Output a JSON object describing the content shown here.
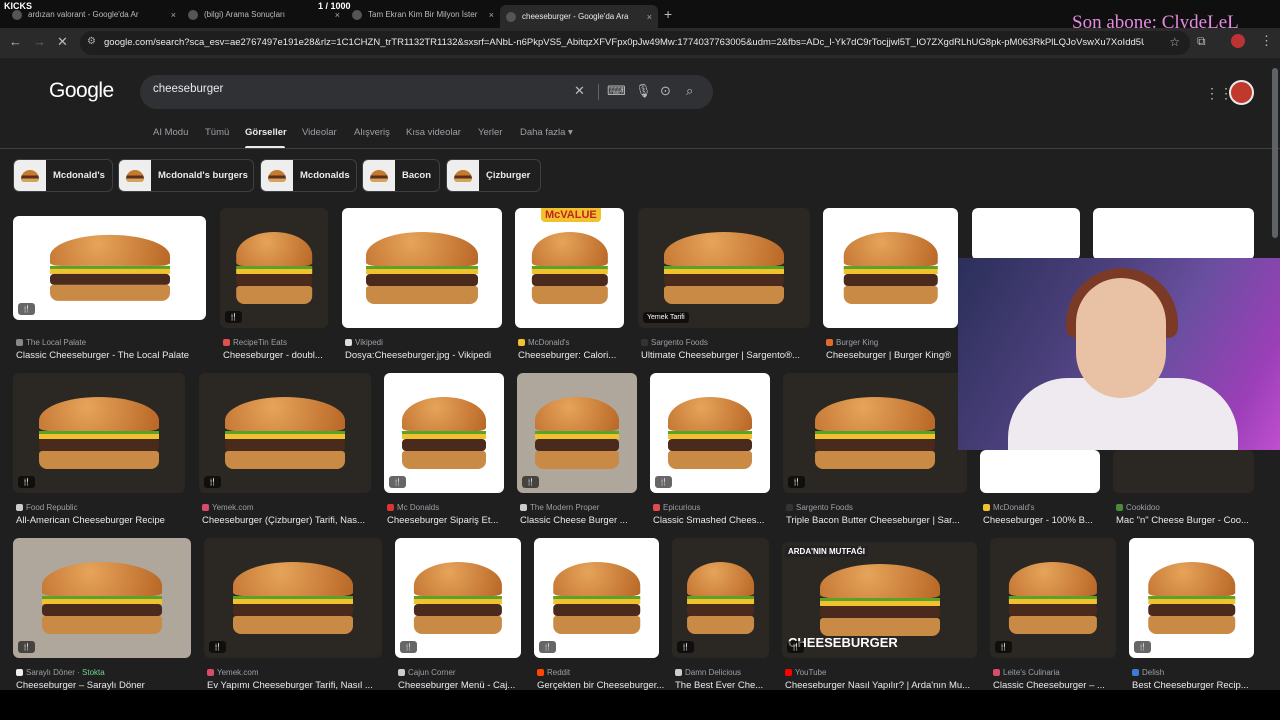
{
  "overlay": {
    "kicks": "KICKS",
    "counter": "1 / 1000",
    "subscriber": "Son abone: ClydeLeL"
  },
  "tabs": [
    {
      "title": "ardızan valorant - Google'da Ar",
      "close": "×"
    },
    {
      "title": "(bilgi) Arama Sonuçları",
      "close": "×"
    },
    {
      "title": "Tam Ekran Kim Bir Milyon İster",
      "close": "×"
    },
    {
      "title": "cheeseburger - Google'da Ara",
      "close": "×"
    }
  ],
  "new_tab": "+",
  "toolbar": {
    "url": "google.com/search?sca_esv=ae2767497e191e28&rlz=1C1CHZN_trTR1132TR1132&sxsrf=ANbL-n6PkpVS5_AbitqzXFVFpx0pJw49Mw:1774037763005&udm=2&fbs=ADc_l-Yk7dC9rTocjjwl5T_IO7ZXgdRLhUG8pk-pM063RkPlLQJoVswXu7XoIdd5UH6fMlpVmVqk..."
  },
  "google": {
    "logo": "Google",
    "query": "cheeseburger",
    "nav": [
      "AI Modu",
      "Tümü",
      "Görseller",
      "Videolar",
      "Alışveriş",
      "Kısa videolar",
      "Yerler",
      "Daha fazla ▾"
    ]
  },
  "chips": [
    "Mcdonald's",
    "Mcdonald's burgers",
    "Mcdonalds",
    "Bacon",
    "Çizburger"
  ],
  "results": [
    {
      "source": "The Local Palate",
      "title": "Classic Cheeseburger - The Local Palate",
      "fav": "#888888"
    },
    {
      "source": "RecipeTin Eats",
      "title": "Cheeseburger - doubl...",
      "fav": "#e05050"
    },
    {
      "source": "Vikipedi",
      "title": "Dosya:Cheeseburger.jpg - Vikipedi",
      "fav": "#dddddd"
    },
    {
      "source": "McDonald's",
      "title": "Cheeseburger: Calori...",
      "fav": "#f2c12e",
      "image_text": "McVALUE"
    },
    {
      "source": "Sargento Foods",
      "title": "Ultimate Cheeseburger | Sargento®...",
      "fav": "#333333",
      "badge": "Yemek Tarifi"
    },
    {
      "source": "Burger King",
      "title": "Cheeseburger | Burger King®",
      "fav": "#e36b2a"
    },
    {
      "source": "",
      "title": "",
      "fav": "#888888"
    },
    {
      "source": "",
      "title": "",
      "fav": "#888888"
    },
    {
      "source": "Food Republic",
      "title": "All-American Cheeseburger Recipe",
      "fav": "#cccccc"
    },
    {
      "source": "Yemek.com",
      "title": "Cheeseburger (Çizburger) Tarifi, Nas...",
      "fav": "#d94b6a"
    },
    {
      "source": "Mc Donalds",
      "title": "Cheeseburger Sipariş Et...",
      "fav": "#d33"
    },
    {
      "source": "The Modern Proper",
      "title": "Classic Cheese Burger ...",
      "fav": "#cccccc"
    },
    {
      "source": "Epicurious",
      "title": "Classic Smashed Chees...",
      "fav": "#e34b4b"
    },
    {
      "source": "Sargento Foods",
      "title": "Triple Bacon Butter Cheeseburger | Sar...",
      "fav": "#333333"
    },
    {
      "source": "McDonald's",
      "title": "Cheeseburger - 100% B...",
      "fav": "#f2c12e"
    },
    {
      "source": "Cookidoo",
      "title": "Mac \"n\" Cheese Burger - Coo...",
      "fav": "#4a8a3a"
    },
    {
      "source": "Saraylı Döner",
      "stock": "Stokta",
      "title": "Cheeseburger – Saraylı Döner",
      "fav": "#eeeeee"
    },
    {
      "source": "Yemek.com",
      "title": "Ev Yapımı Cheeseburger Tarifi, Nasıl ...",
      "fav": "#d94b6a"
    },
    {
      "source": "Cajun Corner",
      "title": "Cheeseburger Menü - Caj...",
      "fav": "#cccccc"
    },
    {
      "source": "Reddit",
      "title": "Gerçekten bir Cheeseburger...",
      "fav": "#ff4500"
    },
    {
      "source": "Damn Delicious",
      "title": "The Best Ever Che...",
      "fav": "#cccccc"
    },
    {
      "source": "YouTube",
      "title": "Cheeseburger Nasıl Yapılır? | Arda'nın Mu...",
      "fav": "#ff0000",
      "image_text": "CHEESEBURGER",
      "image_text2": "ARDA'NIN MUTFAĞI"
    },
    {
      "source": "Leite's Culinaria",
      "title": "Classic Cheeseburger – ...",
      "fav": "#d94b6a"
    },
    {
      "source": "Delish",
      "title": "Best Cheeseburger Recip...",
      "fav": "#3a7bd5"
    }
  ]
}
